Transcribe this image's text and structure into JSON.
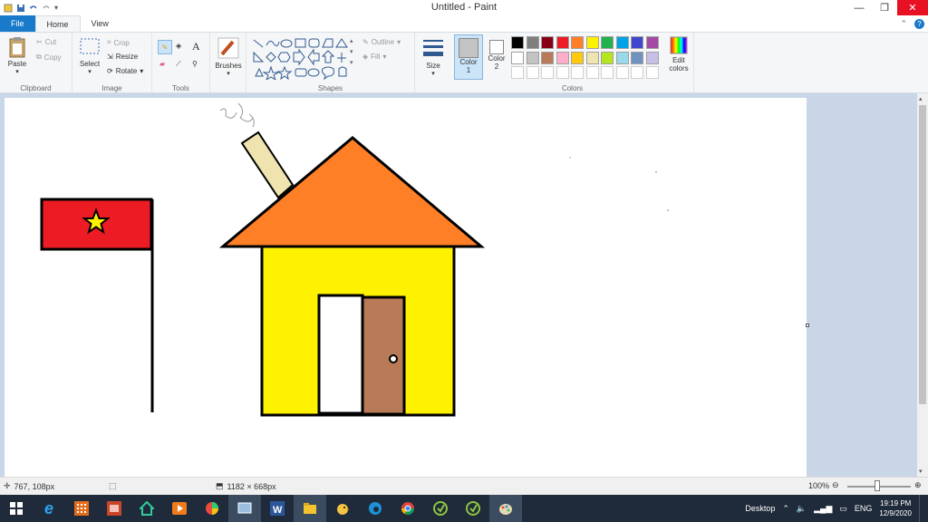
{
  "window": {
    "title": "Untitled - Paint"
  },
  "tabs": {
    "file": "File",
    "home": "Home",
    "view": "View"
  },
  "ribbon": {
    "clipboard": {
      "label": "Clipboard",
      "paste": "Paste",
      "cut": "Cut",
      "copy": "Copy"
    },
    "image": {
      "label": "Image",
      "select": "Select",
      "crop": "Crop",
      "resize": "Resize",
      "rotate": "Rotate"
    },
    "tools": {
      "label": "Tools"
    },
    "brushes": {
      "label": "Brushes"
    },
    "shapes": {
      "label": "Shapes",
      "outline": "Outline",
      "fill": "Fill"
    },
    "size": {
      "label": "Size"
    },
    "color1": {
      "label": "Color",
      "num": "1"
    },
    "color2": {
      "label": "Color",
      "num": "2"
    },
    "colors": {
      "label": "Colors",
      "edit": "Edit",
      "edit2": "colors"
    },
    "palette_row1": [
      "#000000",
      "#7f7f7f",
      "#880015",
      "#ed1c24",
      "#ff7f27",
      "#fff200",
      "#22b14c",
      "#00a2e8",
      "#3f48cc",
      "#a349a4"
    ],
    "palette_row2": [
      "#ffffff",
      "#c3c3c3",
      "#b97a57",
      "#ffaec9",
      "#ffc90e",
      "#efe4b0",
      "#b5e61d",
      "#99d9ea",
      "#7092be",
      "#c8bfe7"
    ]
  },
  "status": {
    "cursor": "767, 108px",
    "canvas_size": "1182 × 668px",
    "zoom": "100%"
  },
  "taskbar": {
    "desktop": "Desktop",
    "lang": "ENG",
    "time": "19:19 PM",
    "date": "12/9/2020"
  },
  "drawing": {
    "flag_color": "#ed1c24",
    "star_color": "#fff200",
    "roof_color": "#ff7f27",
    "wall_color": "#fff200",
    "chimney_color": "#efe4b0",
    "door_color": "#b97a57"
  }
}
